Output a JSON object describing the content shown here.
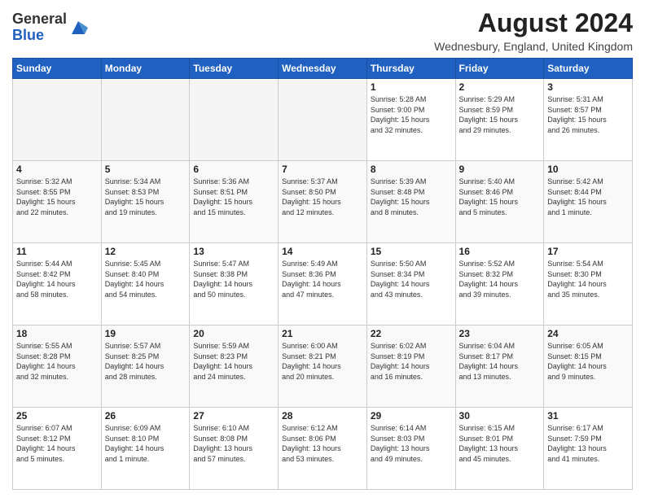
{
  "logo": {
    "general": "General",
    "blue": "Blue"
  },
  "title": "August 2024",
  "subtitle": "Wednesbury, England, United Kingdom",
  "days_of_week": [
    "Sunday",
    "Monday",
    "Tuesday",
    "Wednesday",
    "Thursday",
    "Friday",
    "Saturday"
  ],
  "weeks": [
    [
      {
        "day": "",
        "info": ""
      },
      {
        "day": "",
        "info": ""
      },
      {
        "day": "",
        "info": ""
      },
      {
        "day": "",
        "info": ""
      },
      {
        "day": "1",
        "info": "Sunrise: 5:28 AM\nSunset: 9:00 PM\nDaylight: 15 hours\nand 32 minutes."
      },
      {
        "day": "2",
        "info": "Sunrise: 5:29 AM\nSunset: 8:59 PM\nDaylight: 15 hours\nand 29 minutes."
      },
      {
        "day": "3",
        "info": "Sunrise: 5:31 AM\nSunset: 8:57 PM\nDaylight: 15 hours\nand 26 minutes."
      }
    ],
    [
      {
        "day": "4",
        "info": "Sunrise: 5:32 AM\nSunset: 8:55 PM\nDaylight: 15 hours\nand 22 minutes."
      },
      {
        "day": "5",
        "info": "Sunrise: 5:34 AM\nSunset: 8:53 PM\nDaylight: 15 hours\nand 19 minutes."
      },
      {
        "day": "6",
        "info": "Sunrise: 5:36 AM\nSunset: 8:51 PM\nDaylight: 15 hours\nand 15 minutes."
      },
      {
        "day": "7",
        "info": "Sunrise: 5:37 AM\nSunset: 8:50 PM\nDaylight: 15 hours\nand 12 minutes."
      },
      {
        "day": "8",
        "info": "Sunrise: 5:39 AM\nSunset: 8:48 PM\nDaylight: 15 hours\nand 8 minutes."
      },
      {
        "day": "9",
        "info": "Sunrise: 5:40 AM\nSunset: 8:46 PM\nDaylight: 15 hours\nand 5 minutes."
      },
      {
        "day": "10",
        "info": "Sunrise: 5:42 AM\nSunset: 8:44 PM\nDaylight: 15 hours\nand 1 minute."
      }
    ],
    [
      {
        "day": "11",
        "info": "Sunrise: 5:44 AM\nSunset: 8:42 PM\nDaylight: 14 hours\nand 58 minutes."
      },
      {
        "day": "12",
        "info": "Sunrise: 5:45 AM\nSunset: 8:40 PM\nDaylight: 14 hours\nand 54 minutes."
      },
      {
        "day": "13",
        "info": "Sunrise: 5:47 AM\nSunset: 8:38 PM\nDaylight: 14 hours\nand 50 minutes."
      },
      {
        "day": "14",
        "info": "Sunrise: 5:49 AM\nSunset: 8:36 PM\nDaylight: 14 hours\nand 47 minutes."
      },
      {
        "day": "15",
        "info": "Sunrise: 5:50 AM\nSunset: 8:34 PM\nDaylight: 14 hours\nand 43 minutes."
      },
      {
        "day": "16",
        "info": "Sunrise: 5:52 AM\nSunset: 8:32 PM\nDaylight: 14 hours\nand 39 minutes."
      },
      {
        "day": "17",
        "info": "Sunrise: 5:54 AM\nSunset: 8:30 PM\nDaylight: 14 hours\nand 35 minutes."
      }
    ],
    [
      {
        "day": "18",
        "info": "Sunrise: 5:55 AM\nSunset: 8:28 PM\nDaylight: 14 hours\nand 32 minutes."
      },
      {
        "day": "19",
        "info": "Sunrise: 5:57 AM\nSunset: 8:25 PM\nDaylight: 14 hours\nand 28 minutes."
      },
      {
        "day": "20",
        "info": "Sunrise: 5:59 AM\nSunset: 8:23 PM\nDaylight: 14 hours\nand 24 minutes."
      },
      {
        "day": "21",
        "info": "Sunrise: 6:00 AM\nSunset: 8:21 PM\nDaylight: 14 hours\nand 20 minutes."
      },
      {
        "day": "22",
        "info": "Sunrise: 6:02 AM\nSunset: 8:19 PM\nDaylight: 14 hours\nand 16 minutes."
      },
      {
        "day": "23",
        "info": "Sunrise: 6:04 AM\nSunset: 8:17 PM\nDaylight: 14 hours\nand 13 minutes."
      },
      {
        "day": "24",
        "info": "Sunrise: 6:05 AM\nSunset: 8:15 PM\nDaylight: 14 hours\nand 9 minutes."
      }
    ],
    [
      {
        "day": "25",
        "info": "Sunrise: 6:07 AM\nSunset: 8:12 PM\nDaylight: 14 hours\nand 5 minutes."
      },
      {
        "day": "26",
        "info": "Sunrise: 6:09 AM\nSunset: 8:10 PM\nDaylight: 14 hours\nand 1 minute."
      },
      {
        "day": "27",
        "info": "Sunrise: 6:10 AM\nSunset: 8:08 PM\nDaylight: 13 hours\nand 57 minutes."
      },
      {
        "day": "28",
        "info": "Sunrise: 6:12 AM\nSunset: 8:06 PM\nDaylight: 13 hours\nand 53 minutes."
      },
      {
        "day": "29",
        "info": "Sunrise: 6:14 AM\nSunset: 8:03 PM\nDaylight: 13 hours\nand 49 minutes."
      },
      {
        "day": "30",
        "info": "Sunrise: 6:15 AM\nSunset: 8:01 PM\nDaylight: 13 hours\nand 45 minutes."
      },
      {
        "day": "31",
        "info": "Sunrise: 6:17 AM\nSunset: 7:59 PM\nDaylight: 13 hours\nand 41 minutes."
      }
    ]
  ]
}
